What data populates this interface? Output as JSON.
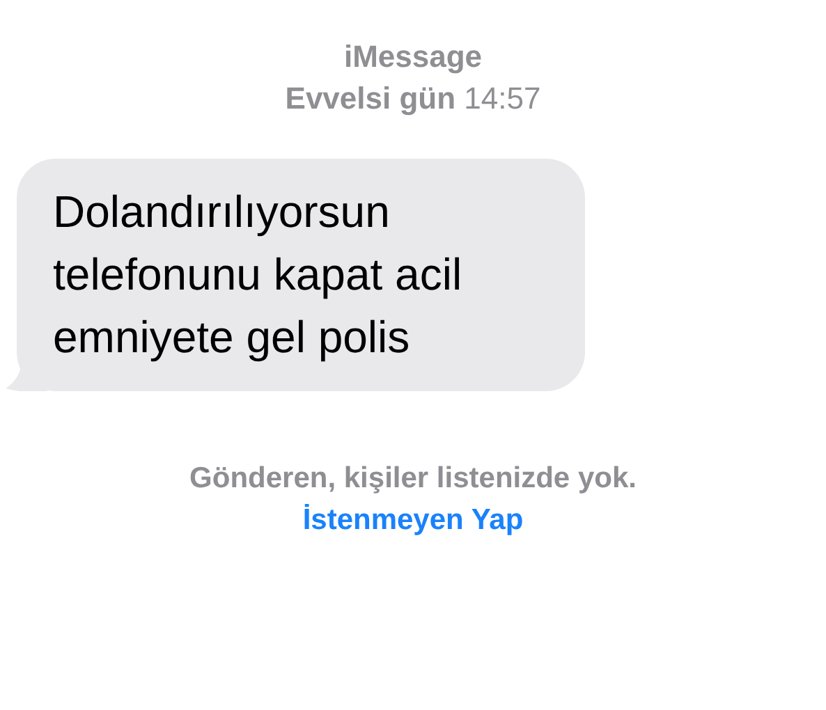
{
  "header": {
    "service": "iMessage",
    "timestamp": "**Evvelsi gün** 14:57"
  },
  "messages": [
    {
      "text": "Dolandırılıyorsun telefonunu kapat acil emniyete gel polis"
    }
  ],
  "notice": {
    "text": "Gönderen, kişiler listenizde yok.",
    "link": "İstenmeyen Yap"
  }
}
